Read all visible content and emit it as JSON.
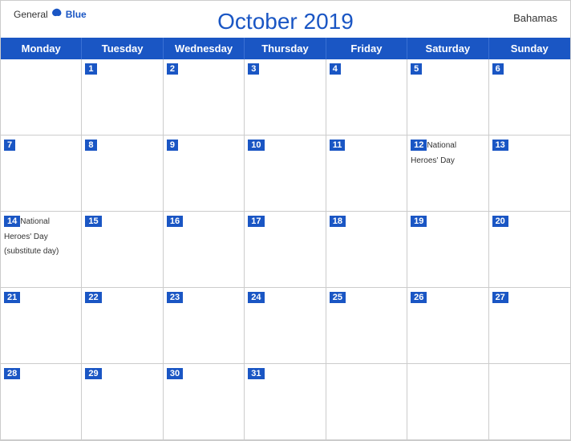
{
  "header": {
    "logo": {
      "general": "General",
      "blue": "Blue",
      "tagline": "GeneralBlue"
    },
    "title": "October 2019",
    "country": "Bahamas"
  },
  "dayHeaders": [
    "Monday",
    "Tuesday",
    "Wednesday",
    "Thursday",
    "Friday",
    "Saturday",
    "Sunday"
  ],
  "weeks": [
    [
      {
        "day": "",
        "empty": true
      },
      {
        "day": "1"
      },
      {
        "day": "2"
      },
      {
        "day": "3"
      },
      {
        "day": "4"
      },
      {
        "day": "5"
      },
      {
        "day": "6"
      }
    ],
    [
      {
        "day": "7"
      },
      {
        "day": "8"
      },
      {
        "day": "9"
      },
      {
        "day": "10"
      },
      {
        "day": "11"
      },
      {
        "day": "12",
        "event": "National Heroes' Day"
      },
      {
        "day": "13"
      }
    ],
    [
      {
        "day": "14",
        "event": "National Heroes' Day (substitute day)"
      },
      {
        "day": "15"
      },
      {
        "day": "16"
      },
      {
        "day": "17"
      },
      {
        "day": "18"
      },
      {
        "day": "19"
      },
      {
        "day": "20"
      }
    ],
    [
      {
        "day": "21"
      },
      {
        "day": "22"
      },
      {
        "day": "23"
      },
      {
        "day": "24"
      },
      {
        "day": "25"
      },
      {
        "day": "26"
      },
      {
        "day": "27"
      }
    ],
    [
      {
        "day": "28"
      },
      {
        "day": "29"
      },
      {
        "day": "30"
      },
      {
        "day": "31"
      },
      {
        "day": "",
        "empty": true
      },
      {
        "day": "",
        "empty": true
      },
      {
        "day": "",
        "empty": true
      }
    ]
  ],
  "colors": {
    "headerBg": "#1a56c4",
    "headerText": "#ffffff",
    "accent": "#1a56c4"
  }
}
